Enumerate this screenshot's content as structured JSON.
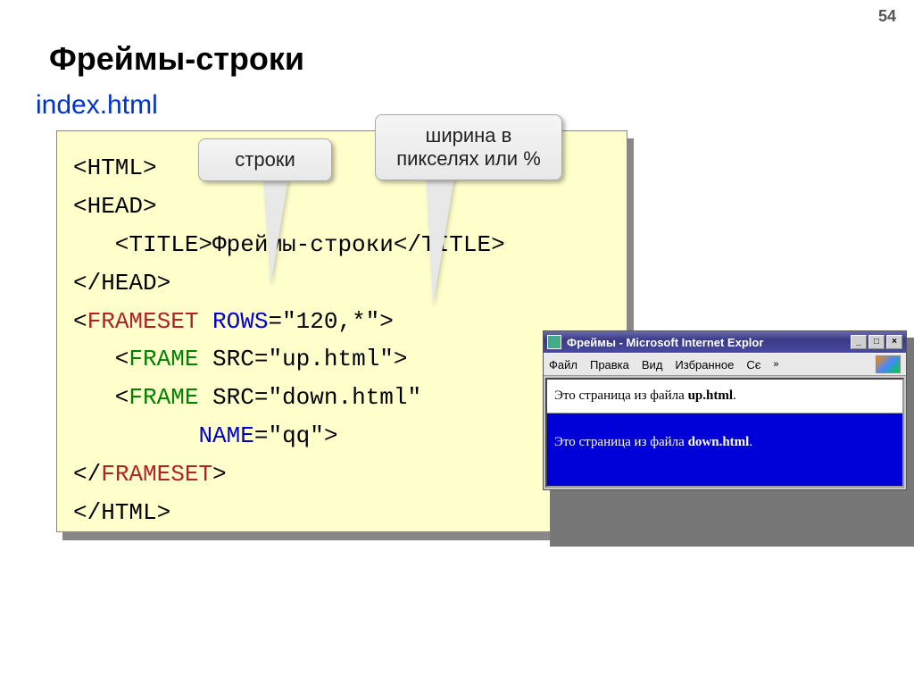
{
  "page_number": "54",
  "title": "Фреймы-строки",
  "subtitle": "index.html",
  "callout1": "строки",
  "callout2_line1": "ширина в",
  "callout2_line2": "пикселях или %",
  "code": {
    "l1": "<HTML>",
    "l2": "<HEAD>",
    "l3a": "   <TITLE>",
    "l3b": "Фреймы-строки",
    "l3c": "</TITLE>",
    "l4": "</HEAD>",
    "l5a": "<",
    "l5b": "FRAMESET",
    "l5c": " ",
    "l5d": "ROWS",
    "l5e": "=\"120,*\">",
    "l6a": "   <",
    "l6b": "FRAME",
    "l6c": " SRC=\"up.html\">",
    "l7a": "   <",
    "l7b": "FRAME",
    "l7c": " SRC=\"down.html\"",
    "l8a": "         ",
    "l8b": "NAME",
    "l8c": "=\"qq\">",
    "l9a": "</",
    "l9b": "FRAMESET",
    "l9c": ">",
    "l10": "</HTML>"
  },
  "browser": {
    "title": "Фреймы - Microsoft Internet Explor",
    "menu": {
      "file": "Файл",
      "edit": "Правка",
      "view": "Вид",
      "fav": "Избранное",
      "more": "Сє",
      "chev": "»"
    },
    "frame_top_pre": "Это страница из файла ",
    "frame_top_bold": "up.html",
    "frame_top_post": ".",
    "frame_bottom_pre": "Это страница из файла ",
    "frame_bottom_bold": "down.html",
    "frame_bottom_post": "."
  }
}
